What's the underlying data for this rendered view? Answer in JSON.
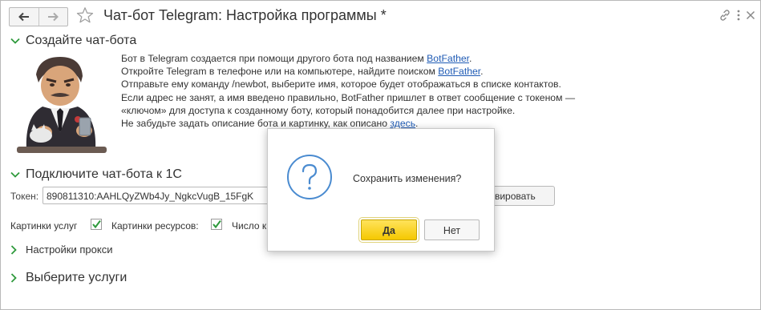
{
  "header": {
    "title": "Чат-бот Telegram: Настройка программы *"
  },
  "section_create": {
    "title": "Создайте чат-бота",
    "line1_prefix": "Бот в Telegram создается при помощи другого бота под названием ",
    "line1_link": "BotFather",
    "line1_suffix": ".",
    "line2_prefix": "Откройте Telegram в телефоне или на компьютере, найдите поиском ",
    "line2_link": "BotFather",
    "line2_suffix": ".",
    "line3": "Отправьте ему команду /newbot, выберите имя, которое будет отображаться в списке контактов.",
    "line4": "Если адрес не занят, а имя введено правильно, BotFather пришлет в ответ сообщение с токеном —",
    "line5": "«ключом» для доступа к созданному боту, который понадобится далее при настройке.",
    "line6_prefix": "Не забудьте задать описание бота и картинку, как описано ",
    "line6_link": "здесь",
    "line6_suffix": "."
  },
  "section_connect": {
    "title": "Подключите чат-бота к 1С",
    "token_label": "Токен:",
    "token_value": "890811310:AAHLQyZWb4Jy_NgkcVugB_15FgK",
    "activate_label": "ивировать",
    "option1_label": "Картинки услуг",
    "option1_checked": true,
    "option2_label": "Картинки ресурсов:",
    "option2_checked": true,
    "option3_label": "Число к",
    "proxy_label": "Настройки прокси"
  },
  "section_services": {
    "title": "Выберите услуги"
  },
  "dialog": {
    "message": "Сохранить изменения?",
    "yes_label": "Да",
    "no_label": "Нет"
  },
  "colors": {
    "accent_green": "#2e9a3c",
    "link_blue": "#1f5bb5",
    "dialog_icon_blue": "#4a8bd0",
    "yes_button_yellow": "#f5c800"
  },
  "icons": {
    "back": "arrow-left-icon",
    "forward": "arrow-right-icon",
    "favorite": "star-icon",
    "link": "link-icon",
    "menu": "more-vertical-icon",
    "close": "close-icon",
    "dialog": "question-icon"
  }
}
